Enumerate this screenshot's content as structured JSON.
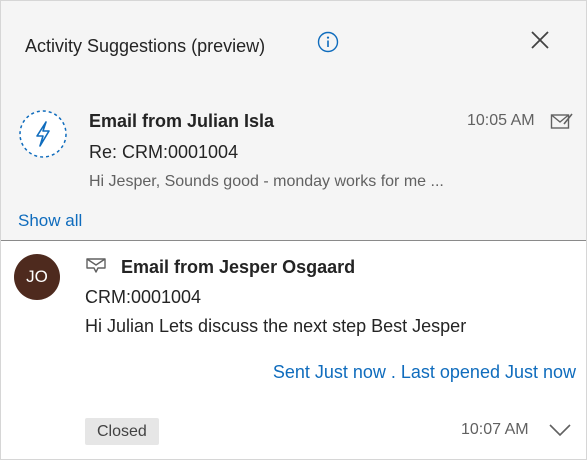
{
  "colors": {
    "accent": "#0f6cbd",
    "avatar_bg": "#4e2a1e",
    "suggest_bg": "#f5f5f5"
  },
  "header": {
    "title": "Activity Suggestions (preview)",
    "info_icon": "info-icon",
    "close_icon": "close-icon"
  },
  "suggestion": {
    "icon": "lightning-bolt-icon",
    "sender": "Email from Julian Isla",
    "time": "10:05 AM",
    "status_icon": "envelope-icon",
    "subject": "Re: CRM:0001004",
    "preview": "Hi Jesper, Sounds good - monday works for me ..."
  },
  "show_all_label": "Show all",
  "email": {
    "avatar_initials": "JO",
    "icon": "sent-email-icon",
    "sender": "Email from Jesper Osgaard",
    "subject": "CRM:0001004",
    "body": "Hi Julian Lets discuss the next step Best Jesper",
    "sent_status": "Sent Just now . Last opened Just now",
    "badge": "Closed",
    "time": "10:07 AM",
    "expand_icon": "chevron-down-icon"
  }
}
